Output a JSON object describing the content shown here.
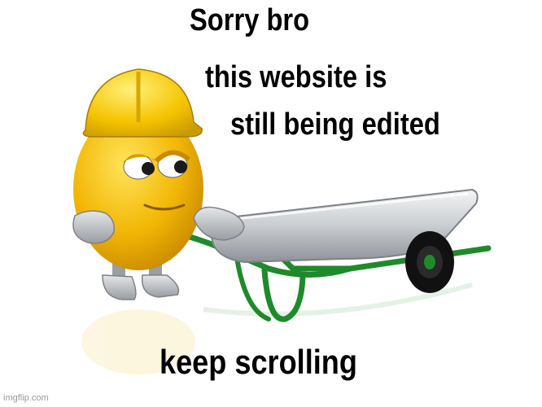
{
  "meme": {
    "top_line_1": "Sorry bro",
    "top_line_2": "this website is",
    "top_line_3": "still being edited",
    "bottom_line": "keep scrolling",
    "watermark": "imgflip.com"
  },
  "illustration": {
    "character": "yellow-emoticon-in-hard-hat",
    "object": "wheelbarrow",
    "colors": {
      "character": "#f2b705",
      "hat": "#f5c400",
      "wheelbarrow_frame": "#1f8a2a",
      "wheelbarrow_tray": "#c9ccd0",
      "tire": "#111111",
      "gloves": "#b9bcc0"
    }
  }
}
